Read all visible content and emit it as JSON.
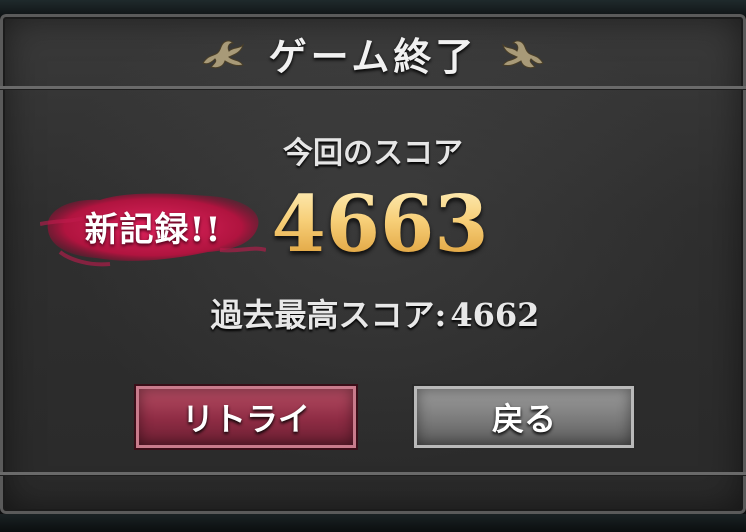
{
  "dialog": {
    "title": "ゲーム終了",
    "current_label": "今回のスコア",
    "current_score": "4663",
    "new_record_badge": "新記録!!",
    "best_label": "過去最高スコア:",
    "best_score": "4662"
  },
  "buttons": {
    "retry_label": "リトライ",
    "back_label": "戻る"
  },
  "colors": {
    "score_gold": "#f3c66b",
    "badge_crimson": "#c0184e",
    "retry_red": "#8e2c44",
    "back_gray": "#7b7b7b"
  }
}
